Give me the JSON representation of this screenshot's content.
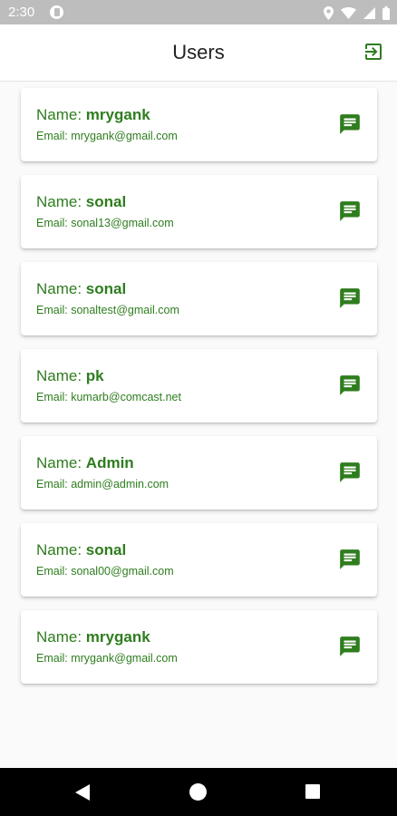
{
  "status_bar": {
    "time": "2:30",
    "icons": [
      "app-notification-icon",
      "location-icon",
      "wifi-icon",
      "signal-icon",
      "battery-icon"
    ]
  },
  "app_bar": {
    "title": "Users",
    "logout_icon": "logout-icon"
  },
  "colors": {
    "accent": "#2e7d1e",
    "status_bar": "#bdbdbd",
    "background": "#fafafa"
  },
  "user_list": {
    "name_prefix": "Name: ",
    "email_prefix": "Email: ",
    "action_icon": "chat-icon",
    "users": [
      {
        "name": "mrygank",
        "email": "mrygank@gmail.com"
      },
      {
        "name": "sonal",
        "email": "sonal13@gmail.com"
      },
      {
        "name": "sonal",
        "email": "sonaltest@gmail.com"
      },
      {
        "name": "pk",
        "email": "kumarb@comcast.net"
      },
      {
        "name": "Admin",
        "email": "admin@admin.com"
      },
      {
        "name": "sonal",
        "email": "sonal00@gmail.com"
      },
      {
        "name": "mrygank",
        "email": "mrygank@gmail.com"
      }
    ]
  },
  "nav_bar": {
    "icons": [
      "back-icon",
      "home-icon",
      "recents-icon"
    ]
  }
}
